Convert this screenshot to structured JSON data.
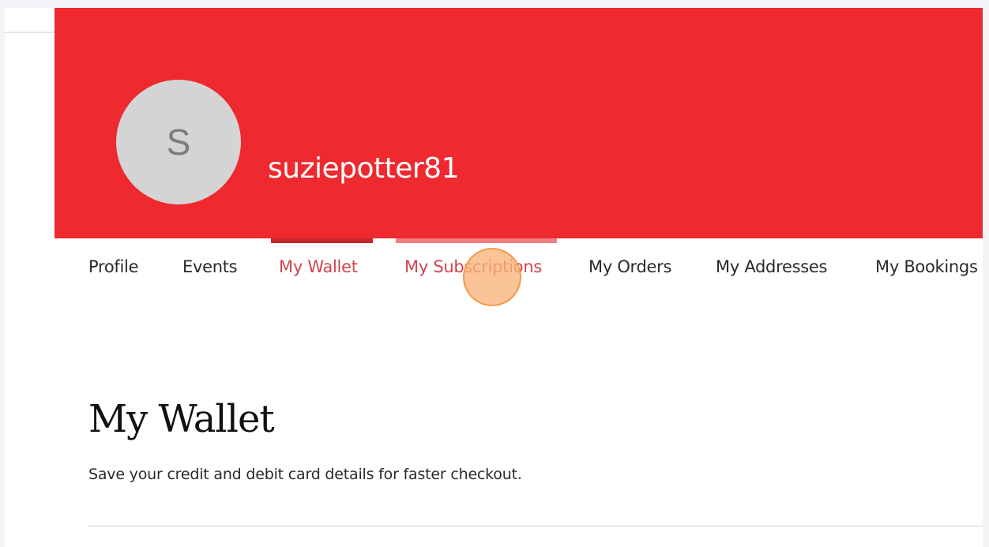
{
  "header": {
    "avatar_initial": "S",
    "username": "suziepotter81",
    "banner_color": "#ee2930"
  },
  "tabs": [
    {
      "label": "Profile",
      "state": "default"
    },
    {
      "label": "Events",
      "state": "default"
    },
    {
      "label": "My Wallet",
      "state": "active"
    },
    {
      "label": "My Subscriptions",
      "state": "hovered"
    },
    {
      "label": "My Orders",
      "state": "default"
    },
    {
      "label": "My Addresses",
      "state": "default"
    },
    {
      "label": "My Bookings",
      "state": "default"
    }
  ],
  "main": {
    "title": "My Wallet",
    "description": "Save your credit and debit card details for faster checkout."
  },
  "colors": {
    "accent_text": "#d1454f",
    "active_indicator": "#c9262c",
    "hover_indicator": "#f07e82",
    "click_marker": "#f8b47a"
  }
}
